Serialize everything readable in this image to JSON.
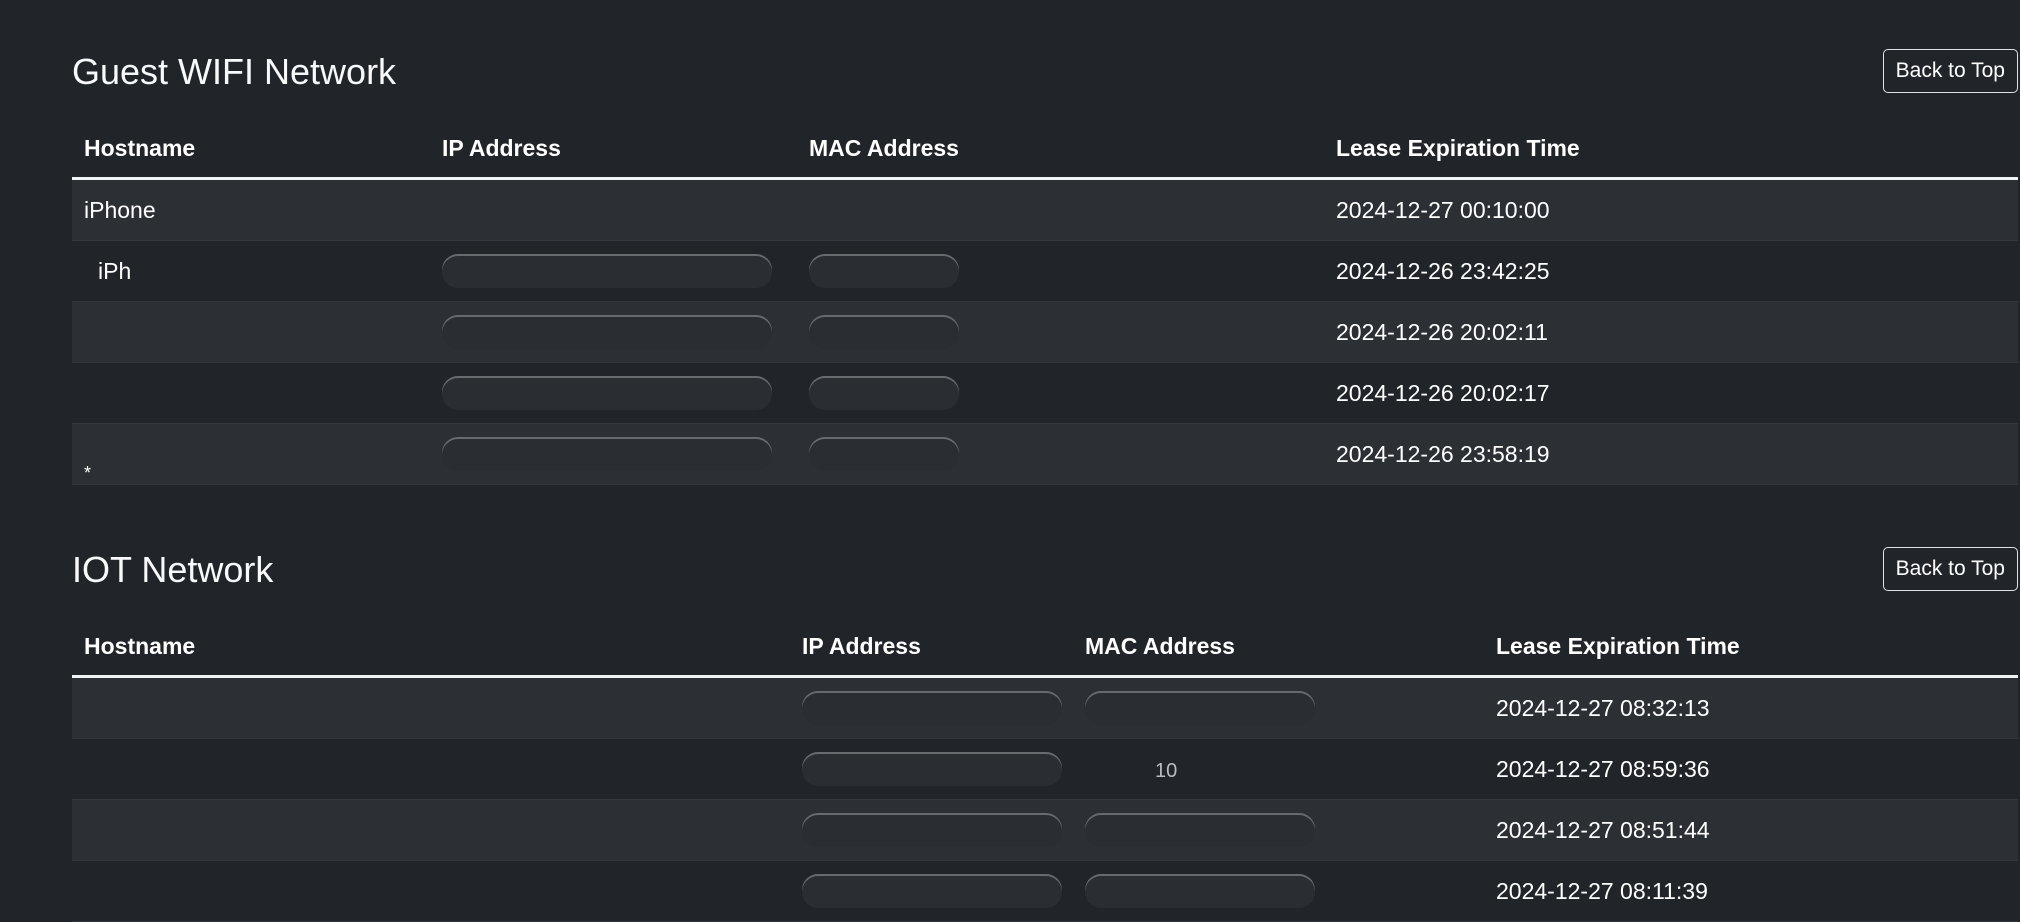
{
  "guest_network": {
    "title": "Guest WIFI Network",
    "back_label": "Back to Top",
    "columns": [
      "Hostname",
      "IP Address",
      "MAC Address",
      "Lease Expiration Time"
    ],
    "rows": [
      {
        "hostname": "iPhone",
        "ip": "",
        "mac": "",
        "expires": "2024-12-27 00:10:00"
      },
      {
        "hostname": "iPh",
        "ip": "",
        "mac": "",
        "expires": "2024-12-26 23:42:25"
      },
      {
        "hostname": "",
        "ip": "",
        "mac": "",
        "expires": "2024-12-26 20:02:11"
      },
      {
        "hostname": "",
        "ip": "",
        "mac": "",
        "expires": "2024-12-26 20:02:17"
      },
      {
        "hostname": "*",
        "ip": "",
        "mac": "",
        "expires": "2024-12-26 23:58:19"
      }
    ]
  },
  "iot_network": {
    "title": "IOT Network",
    "back_label": "Back to Top",
    "columns": [
      "Hostname",
      "IP Address",
      "MAC Address",
      "Lease Expiration Time"
    ],
    "rows": [
      {
        "hostname": "",
        "ip": "",
        "mac": "",
        "expires": "2024-12-27 08:32:13"
      },
      {
        "hostname": "",
        "ip": "",
        "mac": "10",
        "expires": "2024-12-27 08:59:36"
      },
      {
        "hostname": "",
        "ip": "",
        "mac": "",
        "expires": "2024-12-27 08:51:44"
      },
      {
        "hostname": "",
        "ip": "",
        "mac": "",
        "expires": "2024-12-27 08:11:39"
      }
    ]
  },
  "colors": {
    "background": "#212529",
    "row_striped": "#2c3034",
    "text": "#ffffff",
    "header_rule": "#f1f3f5"
  }
}
